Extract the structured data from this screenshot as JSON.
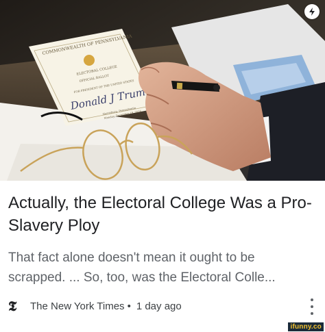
{
  "article": {
    "headline": "Actually, the Electoral College Was a Pro-Slavery Ploy",
    "snippet_line1": "That fact alone doesn't mean it ought to be",
    "snippet_line2": "scrapped. ... So, too, was the Electoral Colle...",
    "source_logo": "𝕿",
    "source_name": "The New York Times",
    "separator": "•",
    "age": "1 day ago"
  },
  "photo": {
    "ballot_header": "COMMONWEALTH OF PENNSYLVANIA",
    "ballot_line1": "ELECTORAL COLLEGE",
    "ballot_line2": "OFFICIAL BALLOT",
    "ballot_line3": "FOR PRESIDENT OF THE UNITED STATES",
    "signature": "Donald J Trump",
    "ballot_footer1": "Harrisburg, Pennsylvania",
    "ballot_footer2": "Monday, December 19, 2016"
  },
  "icons": {
    "badge": "lightning-bolt-icon",
    "menu": "more-vertical-icon"
  },
  "watermark": {
    "text": "ifunny.co"
  },
  "colors": {
    "headline": "#202124",
    "snippet": "#5f6368",
    "watermark_bg": "#1b2b3a",
    "watermark_fg": "#f2c230"
  }
}
